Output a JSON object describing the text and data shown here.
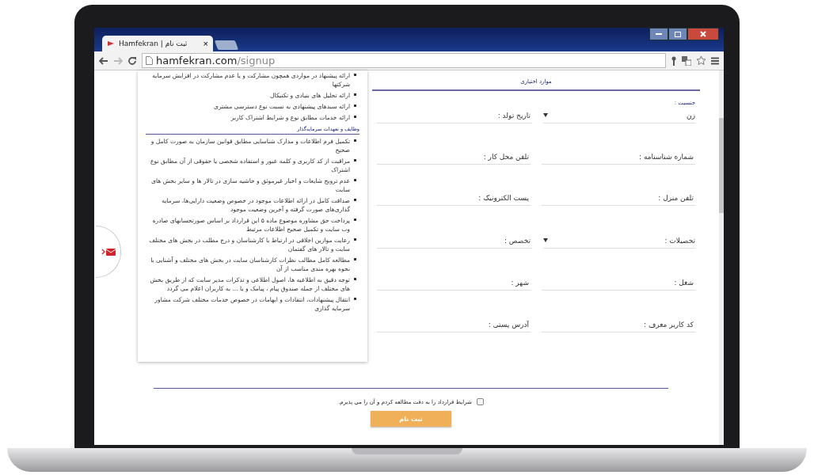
{
  "browser": {
    "tab_title": "Hamfekran | ثبت نام",
    "tab_close": "×",
    "url_host": "hamfekran.com",
    "url_path": "/signup"
  },
  "terms_panel": {
    "items_top": [
      "ارائه پیشنهاد در مواردی همچون مشارکت و یا عدم مشارکت در افزایش سرمایه شرکتها",
      "ارائه تحلیل های بنیادی و تکنیکال",
      "ارائه سبدهای پیشنهادی به نسبت نوع دسترسی مشتری",
      "ارائه خدمات مطابق نوع و شرایط اشتراک کاربر"
    ],
    "heading": "وظایف و تعهدات سرمایه‌گذار",
    "items": [
      "تکمیل فرم اطلاعات و مدارک شناسایی مطابق قوانین سازمان به صورت کامل و صحیح",
      "مراقبت از کد کاربری و کلمه عبور و استفاده شخصی یا حقوقی از آن مطابق نوع اشتراک",
      "عدم ترویج شایعات و اخبار غیرموثق و حاشیه سازی در تالار ها و سایر بخش های سایت",
      "صداقت کامل در ارائه اطلاعات موجود در خصوص وضعیت دارایی‌ها، سرمایه گذاری‌های صورت گرفته و آخرین وضعیت موجود",
      "پرداخت حق مشاوره موضوع ماده ۵ این قرارداد بر اساس صورتحسابهای صادره وب سایت و تکمیل صحیح اطلاعات مرتبط",
      "رعایت موازین اخلاقی در ارتباط با کارشناسان و درج مطلب در بخش های مختلف سایت و تالار های گفتمان",
      "مطالعه کامل مطالب نظرات کارشناسان سایت در بخش های مختلف و آشنایی با نحوه بهره مندی مناسب از آن",
      "توجه دقیق به اطلاعیه ها، اصول اطلاعی و تذکرات مدیر سایت که از طریق بخش های مختلف از جمله صندوق پیام ، پیامک و یا ... به کاربران اعلام می گردد",
      "انتقال پیشنهادات، انتقادات و ابهامات در خصوص خدمات مختلف شرکت مشاور سرمایه گذاری"
    ]
  },
  "form": {
    "section_title": "موارد اختیاری",
    "gender_label": "جنسیت :",
    "rows": [
      [
        {
          "kind": "select",
          "value": "زن"
        },
        {
          "kind": "input",
          "placeholder": "تاریخ تولد :"
        }
      ],
      [
        {
          "kind": "input",
          "placeholder": "شماره شناسنامه :"
        },
        {
          "kind": "input",
          "placeholder": "تلفن محل کار :"
        }
      ],
      [
        {
          "kind": "input",
          "placeholder": "تلفن منزل :"
        },
        {
          "kind": "input",
          "placeholder": "پست الکترونیک :"
        }
      ],
      [
        {
          "kind": "select",
          "placeholder": "تحصیلات :"
        },
        {
          "kind": "input",
          "placeholder": "تخصص :"
        }
      ],
      [
        {
          "kind": "input",
          "placeholder": "شغل :"
        },
        {
          "kind": "input",
          "placeholder": "شهر :"
        }
      ],
      [
        {
          "kind": "input",
          "placeholder": "کد کاربر معرف :"
        },
        {
          "kind": "input",
          "placeholder": "آدرس پستی :"
        }
      ]
    ]
  },
  "agreement": {
    "checked": false,
    "text": "شرایط قرارداد را به دقت مطالعه کردم و آن را می پذیرم."
  },
  "submit": "ثبت نام"
}
